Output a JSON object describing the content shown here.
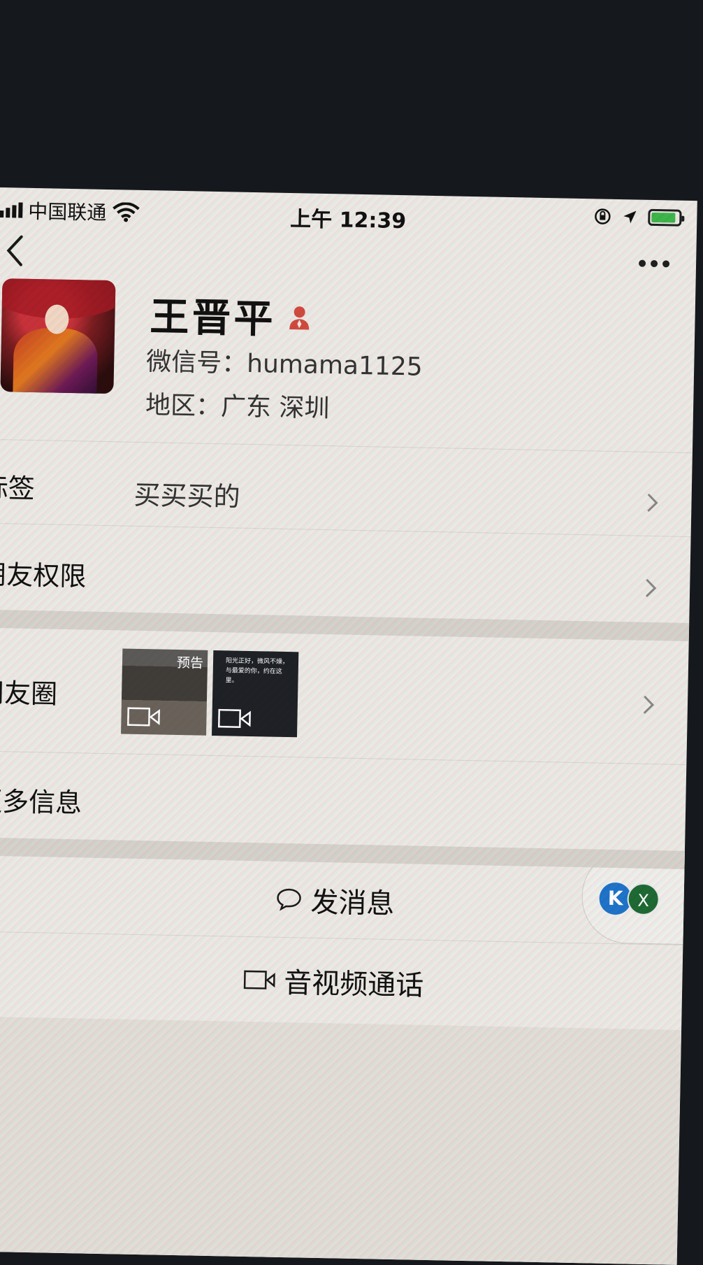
{
  "status_bar": {
    "carrier": "中国联通",
    "time": "上午 12:39",
    "battery_level": 0.9
  },
  "nav": {
    "back_icon": "chevron-left-icon",
    "more_icon": "more-dots-icon"
  },
  "profile": {
    "name": "王晋平",
    "wechat_id": "微信号：humama1125",
    "region": "地区：广东 深圳",
    "gender_icon": "person-icon"
  },
  "rows": {
    "tags_label": "标签",
    "tags_value": "买买买的",
    "moments_permission_label": "朋友权限",
    "moments_label": "朋友圈",
    "more_info_label": "更多信息"
  },
  "moments_thumbs": [
    {
      "badge": "预告",
      "type": "video"
    },
    {
      "text": "阳光正好，微风不燥，与最爱的你，约在这里。",
      "type": "video"
    }
  ],
  "floating": {
    "kb_label": "K",
    "x_label": "X"
  },
  "actions": {
    "send_message": "发消息",
    "video_call": "音视频通话"
  },
  "colors": {
    "background": "#ece9e4",
    "accent_red": "#d04a3e",
    "battery_green": "#3db54a"
  }
}
